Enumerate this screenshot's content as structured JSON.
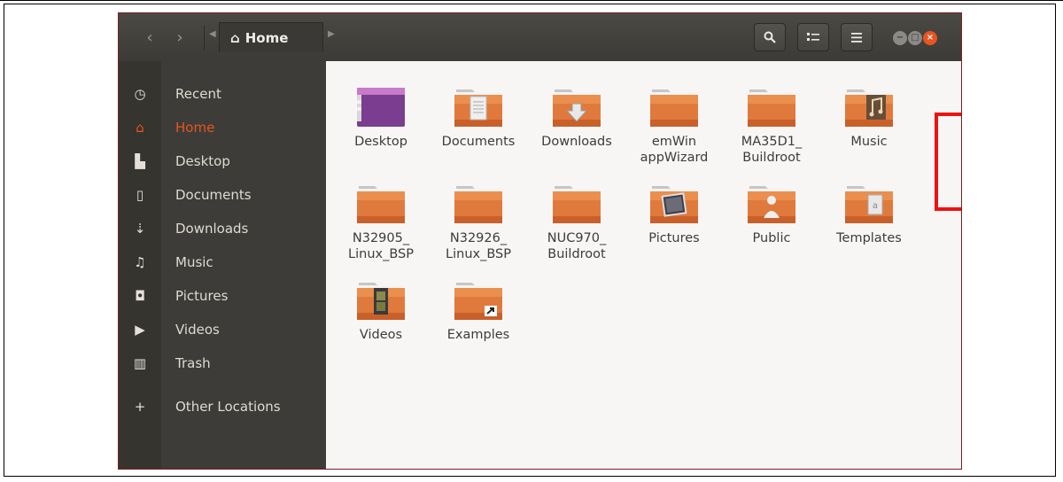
{
  "toolbar": {
    "back_icon": "chevron-left-icon",
    "forward_icon": "chevron-right-icon",
    "location": "Home",
    "search_icon": "search-icon",
    "view_icon": "list-view-icon",
    "menu_icon": "hamburger-menu-icon"
  },
  "window_controls": {
    "minimize": "−",
    "maximize": "□",
    "close": "×",
    "close_color": "#e95420",
    "button_color": "#8c8a84"
  },
  "sidebar": {
    "items": [
      {
        "label": "Recent",
        "icon": "clock-icon",
        "glyph": "◷"
      },
      {
        "label": "Home",
        "icon": "home-icon",
        "glyph": "⌂"
      },
      {
        "label": "Desktop",
        "icon": "folder-icon",
        "glyph": "▙"
      },
      {
        "label": "Documents",
        "icon": "document-icon",
        "glyph": "▯"
      },
      {
        "label": "Downloads",
        "icon": "download-icon",
        "glyph": "⇣"
      },
      {
        "label": "Music",
        "icon": "music-icon",
        "glyph": "♫"
      },
      {
        "label": "Pictures",
        "icon": "camera-icon",
        "glyph": "◘"
      },
      {
        "label": "Videos",
        "icon": "video-icon",
        "glyph": "▶"
      },
      {
        "label": "Trash",
        "icon": "trash-icon",
        "glyph": "▥"
      },
      {
        "label": "Other Locations",
        "icon": "plus-icon",
        "glyph": "+"
      }
    ],
    "active_index": 1,
    "accent": "#e95420"
  },
  "files": [
    {
      "name": "Desktop",
      "emblem": "desktop"
    },
    {
      "name": "Documents",
      "emblem": "documents"
    },
    {
      "name": "Downloads",
      "emblem": "downloads"
    },
    {
      "name": "emWin\nappWizard",
      "emblem": "none"
    },
    {
      "name": "MA35D1_\nBuildroot",
      "emblem": "none"
    },
    {
      "name": "Music",
      "emblem": "music"
    },
    {
      "name": "N32905_\nLinux_BSP",
      "emblem": "none"
    },
    {
      "name": "N32926_\nLinux_BSP",
      "emblem": "none"
    },
    {
      "name": "NUC970_\nBuildroot",
      "emblem": "none"
    },
    {
      "name": "Pictures",
      "emblem": "pictures"
    },
    {
      "name": "Public",
      "emblem": "public"
    },
    {
      "name": "Templates",
      "emblem": "templates"
    },
    {
      "name": "Videos",
      "emblem": "videos"
    },
    {
      "name": "Examples",
      "emblem": "link"
    }
  ],
  "highlighted_file": "MA35D1_\nBuildroot",
  "highlight_color": "#ee1111"
}
